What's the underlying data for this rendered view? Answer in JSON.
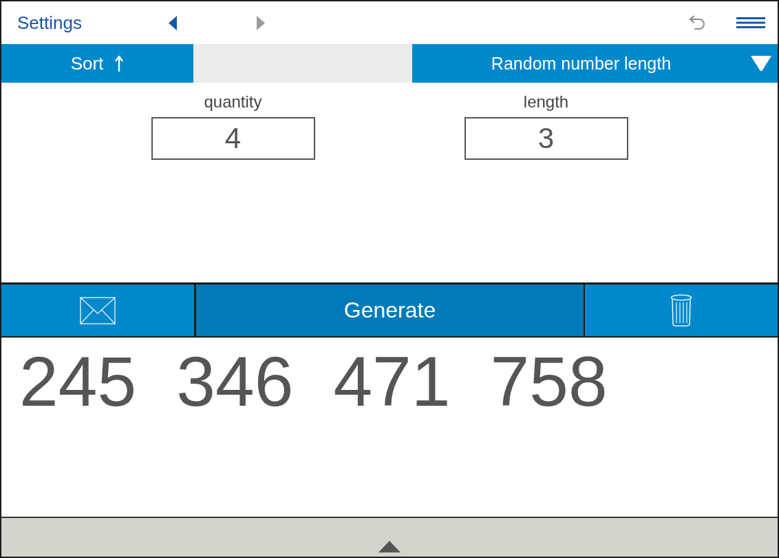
{
  "top_bar": {
    "title": "Settings",
    "nav": [
      {
        "kind": "back",
        "disabled": false
      },
      {
        "kind": "forward",
        "disabled": true
      }
    ]
  },
  "tab_row": {
    "sort": {
      "label": "Sort",
      "ascending": true
    },
    "dropdown": {
      "label": "Random number length"
    }
  },
  "fields": [
    {
      "label": "quantity",
      "value": "4"
    },
    {
      "label": "length",
      "value": "3"
    }
  ],
  "toolbar": {
    "generate": "Generate"
  },
  "results": [
    "245",
    "346",
    "471",
    "758"
  ]
}
